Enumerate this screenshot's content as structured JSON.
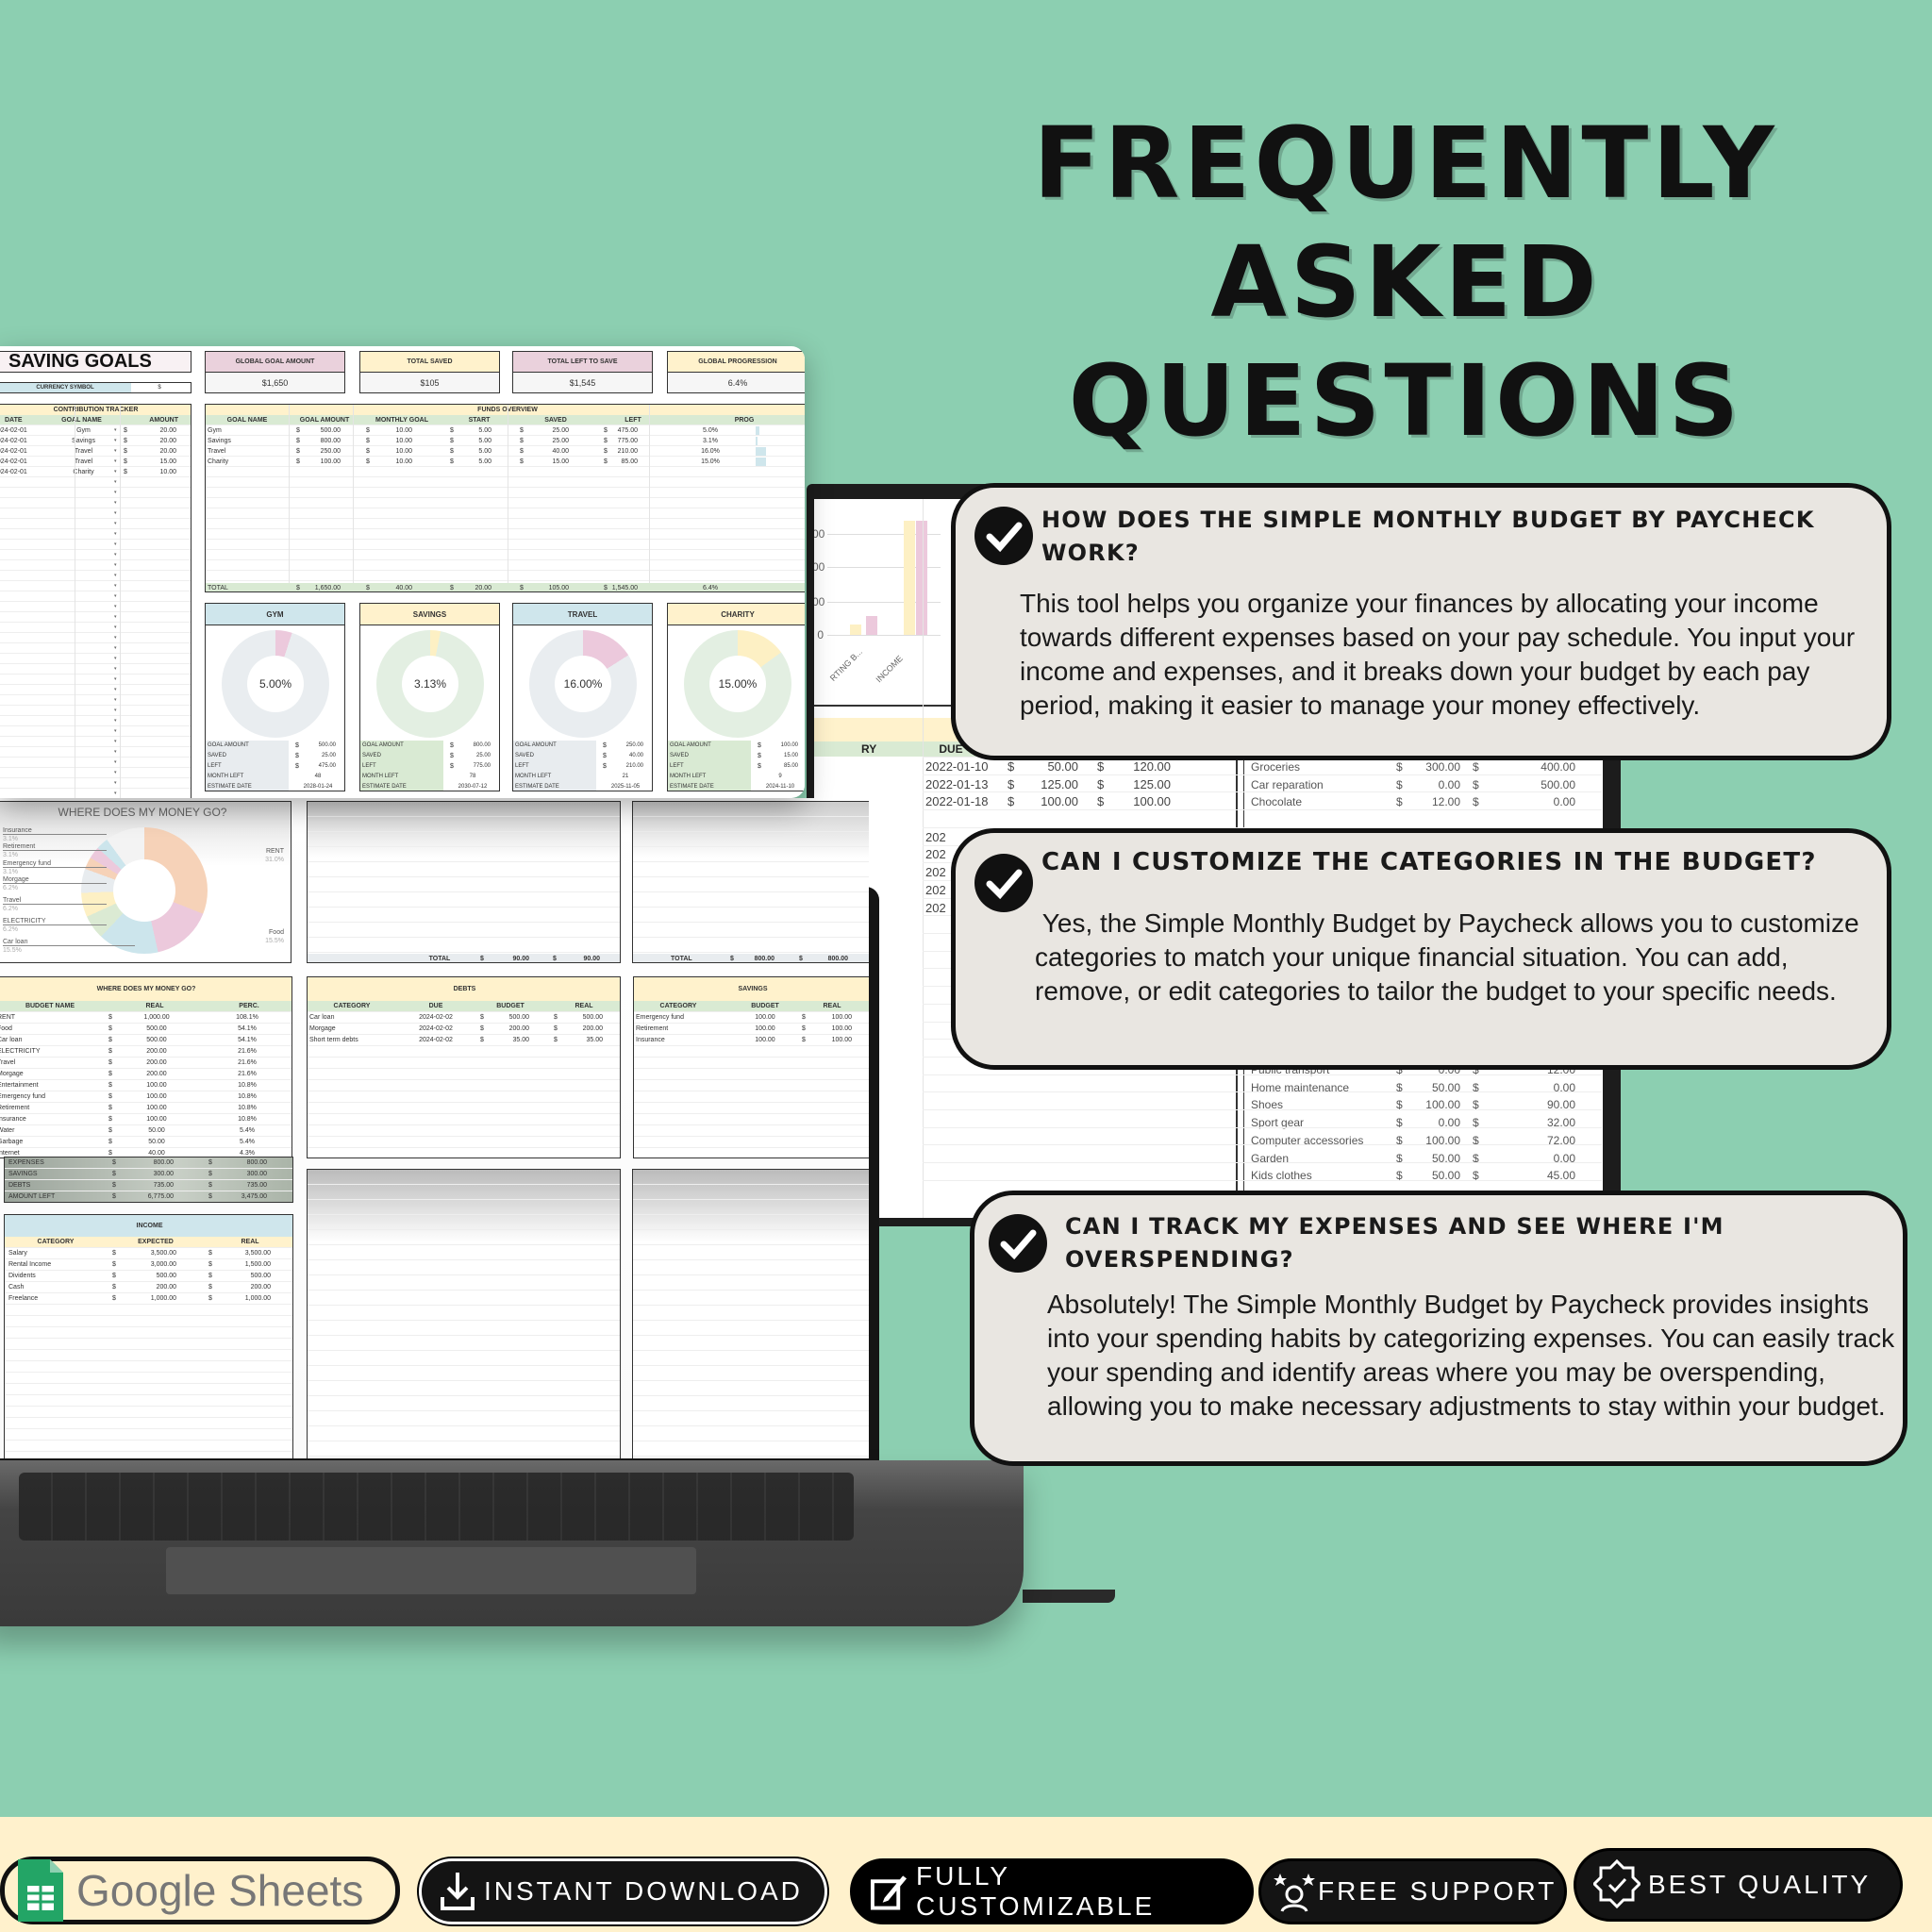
{
  "title": {
    "lines": [
      "FREQUENTLY",
      "ASKED",
      "QUESTIONS"
    ]
  },
  "faq": [
    {
      "question": "HOW DOES THE SIMPLE MONTHLY BUDGET BY PAYCHECK WORK?",
      "answer": "This tool helps you organize your finances by allocating your income towards different expenses based on your pay schedule. You input your income and expenses, and it breaks down your budget by each pay period, making it easier to manage your money effectively."
    },
    {
      "question": "CAN I CUSTOMIZE THE CATEGORIES IN THE BUDGET?",
      "answer": " Yes, the Simple Monthly Budget by Paycheck allows you to customize categories to match your unique financial situation. You can add, remove, or edit categories to tailor the budget to your specific needs."
    },
    {
      "question": "CAN I TRACK MY EXPENSES AND SEE WHERE I'M OVERSPENDING?",
      "answer": "Absolutely! The Simple Monthly Budget by Paycheck provides insights into your spending habits by categorizing expenses. You can easily track your spending and identify areas where you may be overspending, allowing you to make necessary adjustments to stay within your budget."
    }
  ],
  "badges": [
    {
      "label": "Google Sheets",
      "icon": "google-sheets-icon"
    },
    {
      "label": "INSTANT DOWNLOAD",
      "icon": "download-icon"
    },
    {
      "label": "FULLY CUSTOMIZABLE",
      "icon": "edit-icon"
    },
    {
      "label": "FREE SUPPORT",
      "icon": "support-icon"
    },
    {
      "label": "BEST QUALITY",
      "icon": "quality-badge-icon"
    }
  ],
  "colors": {
    "background": "#8ccfb1",
    "bottom_bar": "#fff1cc",
    "card": "#e9e6e1",
    "sheet_yellow": "#fff2cc",
    "sheet_green": "#d9ead3",
    "sheet_pink": "#ead1dc",
    "sheet_blue": "#cfe6ec"
  },
  "saving_goals": {
    "title": "SAVING GOALS",
    "currency_label": "CURRENCY SYMBOL",
    "currency_value": "$",
    "summary": [
      {
        "label": "GLOBAL GOAL AMOUNT",
        "value": "$1,650"
      },
      {
        "label": "TOTAL SAVED",
        "value": "$105"
      },
      {
        "label": "TOTAL LEFT TO SAVE",
        "value": "$1,545"
      },
      {
        "label": "GLOBAL PROGRESSION",
        "value": "6.4%"
      }
    ],
    "contribution": {
      "title": "CONTRIBUTION TRACKER",
      "headers": [
        "DATE",
        "GOAL NAME",
        "AMOUNT"
      ],
      "rows": [
        [
          "2024-02-01",
          "Gym",
          "$",
          "20.00"
        ],
        [
          "2024-02-01",
          "Savings",
          "$",
          "20.00"
        ],
        [
          "2024-02-01",
          "Travel",
          "$",
          "20.00"
        ],
        [
          "2024-02-01",
          "Travel",
          "$",
          "15.00"
        ],
        [
          "2024-02-01",
          "Charity",
          "$",
          "10.00"
        ]
      ]
    },
    "funds": {
      "title": "FUNDS OVERVIEW",
      "headers": [
        "GOAL NAME",
        "GOAL AMOUNT",
        "MONTHLY GOAL",
        "START",
        "SAVED",
        "LEFT",
        "PROG"
      ],
      "rows": [
        [
          "Gym",
          "$",
          "500.00",
          "$",
          "10.00",
          "$",
          "5.00",
          "$",
          "25.00",
          "$",
          "475.00",
          "5.0%"
        ],
        [
          "Savings",
          "$",
          "800.00",
          "$",
          "10.00",
          "$",
          "5.00",
          "$",
          "25.00",
          "$",
          "775.00",
          "3.1%"
        ],
        [
          "Travel",
          "$",
          "250.00",
          "$",
          "10.00",
          "$",
          "5.00",
          "$",
          "40.00",
          "$",
          "210.00",
          "16.0%"
        ],
        [
          "Charity",
          "$",
          "100.00",
          "$",
          "10.00",
          "$",
          "5.00",
          "$",
          "15.00",
          "$",
          "85.00",
          "15.0%"
        ]
      ],
      "progress": [
        0.05,
        0.031,
        0.16,
        0.15
      ],
      "total": [
        [
          "TOTAL",
          "$",
          "1,650.00",
          "$",
          "40.00",
          "$",
          "20.00",
          "$",
          "105.00",
          "$",
          "1,545.00",
          "6.4%"
        ]
      ]
    },
    "goals": [
      {
        "name": "GYM",
        "percent": "5.00%",
        "fraction": 0.05,
        "stats": [
          [
            "GOAL AMOUNT",
            "$",
            "500.00"
          ],
          [
            "SAVED",
            "$",
            "25.00"
          ],
          [
            "LEFT",
            "$",
            "475.00"
          ],
          [
            "MONTH LEFT",
            "",
            "48"
          ],
          [
            "ESTIMATE DATE",
            "",
            "2028-01-24"
          ]
        ]
      },
      {
        "name": "SAVINGS",
        "percent": "3.13%",
        "fraction": 0.0313,
        "stats": [
          [
            "GOAL AMOUNT",
            "$",
            "800.00"
          ],
          [
            "SAVED",
            "$",
            "25.00"
          ],
          [
            "LEFT",
            "$",
            "775.00"
          ],
          [
            "MONTH LEFT",
            "",
            "78"
          ],
          [
            "ESTIMATE DATE",
            "",
            "2030-07-12"
          ]
        ]
      },
      {
        "name": "TRAVEL",
        "percent": "16.00%",
        "fraction": 0.16,
        "stats": [
          [
            "GOAL AMOUNT",
            "$",
            "250.00"
          ],
          [
            "SAVED",
            "$",
            "40.00"
          ],
          [
            "LEFT",
            "$",
            "210.00"
          ],
          [
            "MONTH LEFT",
            "",
            "21"
          ],
          [
            "ESTIMATE DATE",
            "",
            "2025-11-05"
          ]
        ]
      },
      {
        "name": "CHARITY",
        "percent": "15.00%",
        "fraction": 0.15,
        "stats": [
          [
            "GOAL AMOUNT",
            "$",
            "100.00"
          ],
          [
            "SAVED",
            "$",
            "15.00"
          ],
          [
            "LEFT",
            "$",
            "85.00"
          ],
          [
            "MONTH LEFT",
            "",
            "9"
          ],
          [
            "ESTIMATE DATE",
            "",
            "2024-11-10"
          ]
        ]
      }
    ]
  },
  "budget": {
    "pie": {
      "title": "WHERE DOES MY MONEY GO?",
      "slices": [
        {
          "label": "RENT",
          "percent": "31.0%",
          "value": 31.0,
          "color": "#f6d2b8"
        },
        {
          "label": "Food",
          "percent": "15.5%",
          "value": 15.5,
          "color": "#ecc9dc"
        },
        {
          "label": "Car loan",
          "percent": "15.5%",
          "value": 15.5,
          "color": "#cce5ec"
        },
        {
          "label": "ELECTRICITY",
          "percent": "6.2%",
          "value": 6.2,
          "color": "#dbead3"
        },
        {
          "label": "Travel",
          "percent": "6.2%",
          "value": 6.2,
          "color": "#fdf0c4"
        },
        {
          "label": "Morgage",
          "percent": "6.2%",
          "value": 6.2,
          "color": "#e8ecef"
        },
        {
          "label": "Emergency fund",
          "percent": "3.1%",
          "value": 3.1,
          "color": "#f6d2b8"
        },
        {
          "label": "Retirement",
          "percent": "3.1%",
          "value": 3.1,
          "color": "#ecc9dc"
        },
        {
          "label": "Insurance",
          "percent": "3.1%",
          "value": 3.1,
          "color": "#cce5ec"
        }
      ],
      "other_value": 10.3
    },
    "totals_a": [
      "TOTAL",
      "$",
      "90.00",
      "$",
      "90.00"
    ],
    "totals_b": [
      "TOTAL",
      "$",
      "800.00",
      "$",
      "800.00"
    ],
    "money": {
      "title": "WHERE DOES MY MONEY GO?",
      "headers": [
        "BUDGET NAME",
        "REAL",
        "PERC."
      ],
      "rows": [
        [
          "RENT",
          "$",
          "1,000.00",
          "108.1%"
        ],
        [
          "Food",
          "$",
          "500.00",
          "54.1%"
        ],
        [
          "Car loan",
          "$",
          "500.00",
          "54.1%"
        ],
        [
          "ELECTRICITY",
          "$",
          "200.00",
          "21.6%"
        ],
        [
          "Travel",
          "$",
          "200.00",
          "21.6%"
        ],
        [
          "Morgage",
          "$",
          "200.00",
          "21.6%"
        ],
        [
          "Entertainment",
          "$",
          "100.00",
          "10.8%"
        ],
        [
          "Emergency fund",
          "$",
          "100.00",
          "10.8%"
        ],
        [
          "Retirement",
          "$",
          "100.00",
          "10.8%"
        ],
        [
          "Insurance",
          "$",
          "100.00",
          "10.8%"
        ],
        [
          "Water",
          "$",
          "50.00",
          "5.4%"
        ],
        [
          "Garbage",
          "$",
          "50.00",
          "5.4%"
        ],
        [
          "Internet",
          "$",
          "40.00",
          "4.3%"
        ]
      ]
    },
    "debts": {
      "title": "DEBTS",
      "headers": [
        "CATEGORY",
        "DUE",
        "BUDGET",
        "REAL"
      ],
      "rows": [
        [
          "Car loan",
          "2024-02-02",
          "$",
          "500.00",
          "$",
          "500.00"
        ],
        [
          "Morgage",
          "2024-02-02",
          "$",
          "200.00",
          "$",
          "200.00"
        ],
        [
          "Short term debts",
          "2024-02-02",
          "$",
          "35.00",
          "$",
          "35.00"
        ]
      ]
    },
    "savings": {
      "title": "SAVINGS",
      "headers": [
        "CATEGORY",
        "BUDGET",
        "REAL"
      ],
      "rows": [
        [
          "Emergency fund",
          "100.00",
          "$",
          "100.00"
        ],
        [
          "Retirement",
          "100.00",
          "$",
          "100.00"
        ],
        [
          "Insurance",
          "100.00",
          "$",
          "100.00"
        ]
      ]
    },
    "summary": [
      [
        "EXPENSES",
        "$",
        "800.00",
        "$",
        "800.00"
      ],
      [
        "SAVINGS",
        "$",
        "300.00",
        "$",
        "300.00"
      ],
      [
        "DEBTS",
        "$",
        "735.00",
        "$",
        "735.00"
      ],
      [
        "AMOUNT LEFT",
        "$",
        "6,775.00",
        "$",
        "3,475.00"
      ]
    ],
    "income": {
      "title": "INCOME",
      "headers": [
        "CATEGORY",
        "EXPECTED",
        "REAL"
      ],
      "rows": [
        [
          "Salary",
          "$",
          "3,500.00",
          "$",
          "3,500.00"
        ],
        [
          "Rental Income",
          "$",
          "3,000.00",
          "$",
          "1,500.00"
        ],
        [
          "Dividents",
          "$",
          "500.00",
          "$",
          "500.00"
        ],
        [
          "Cash",
          "$",
          "200.00",
          "$",
          "200.00"
        ],
        [
          "Freelance",
          "$",
          "1,000.00",
          "$",
          "1,000.00"
        ]
      ]
    }
  },
  "background_sheet": {
    "chart": {
      "y_ticks": [
        ",000",
        ",000",
        ",000",
        "0"
      ],
      "x_labels": [
        "RTING B...",
        "INCOME"
      ],
      "bars": [
        [
          0.1,
          0.18
        ],
        [
          0.5,
          0.5
        ]
      ]
    },
    "headers": [
      "RY",
      "DUE"
    ],
    "bills": [
      [
        "2022-01-10",
        "$",
        "50.00",
        "$",
        "120.00"
      ],
      [
        "2022-01-13",
        "$",
        "125.00",
        "$",
        "125.00"
      ],
      [
        "2022-01-18",
        "$",
        "100.00",
        "$",
        "100.00"
      ]
    ],
    "bill_dates_partial": [
      "202",
      "202",
      "202",
      "202",
      "202"
    ],
    "expenses_top": [
      [
        "Groceries",
        "$",
        "300.00",
        "$",
        "400.00"
      ],
      [
        "Car reparation",
        "$",
        "0.00",
        "$",
        "500.00"
      ],
      [
        "Chocolate",
        "$",
        "12.00",
        "$",
        "0.00"
      ]
    ],
    "expenses_bottom": [
      [
        "Public transport",
        "$",
        "0.00",
        "$",
        "12.00"
      ],
      [
        "Home maintenance",
        "$",
        "50.00",
        "$",
        "0.00"
      ],
      [
        "Shoes",
        "$",
        "100.00",
        "$",
        "90.00"
      ],
      [
        "Sport gear",
        "$",
        "0.00",
        "$",
        "32.00"
      ],
      [
        "Computer accessories",
        "$",
        "100.00",
        "$",
        "72.00"
      ],
      [
        "Garden",
        "$",
        "50.00",
        "$",
        "0.00"
      ],
      [
        "Kids clothes",
        "$",
        "50.00",
        "$",
        "45.00"
      ]
    ]
  }
}
